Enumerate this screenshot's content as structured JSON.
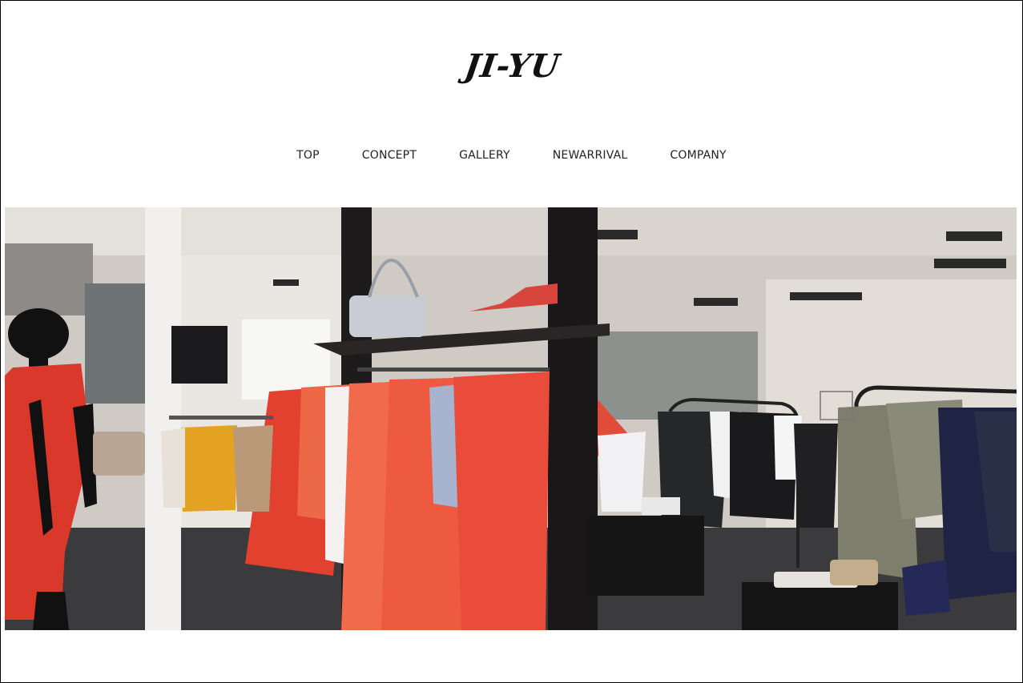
{
  "brand": {
    "logo": "JI-YU"
  },
  "nav": {
    "items": [
      {
        "label": "TOP"
      },
      {
        "label": "CONCEPT"
      },
      {
        "label": "GALLERY"
      },
      {
        "label": "NEWARRIVAL"
      },
      {
        "label": "COMPANY"
      }
    ]
  },
  "colors": {
    "background": "#ffffff",
    "text": "#222222",
    "accent_red": "#e8473a"
  },
  "hero": {
    "icon": "boutique-photo"
  }
}
